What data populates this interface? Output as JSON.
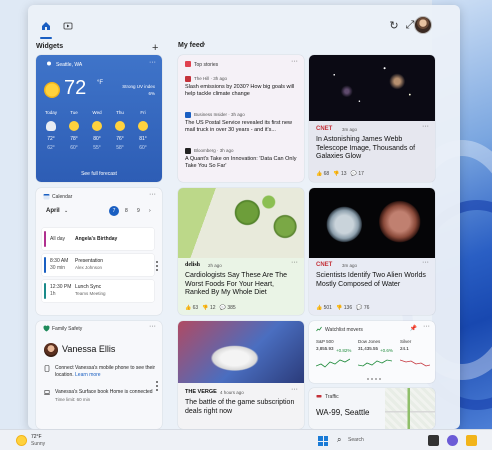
{
  "topbar": {
    "home_icon": "home-icon",
    "media_icon": "media-icon",
    "refresh_icon": "refresh-icon",
    "expand_icon": "expand-icon"
  },
  "widgets_section": {
    "label": "Widgets",
    "add": "+"
  },
  "weather": {
    "location": "Seattle, WA",
    "temp": "72",
    "unit": "°F",
    "condition_line1": "Strong UV index",
    "condition_line2": "6%",
    "forecast": [
      {
        "day": "Today",
        "icon": "cloud",
        "hi": "72°",
        "lo": "62°"
      },
      {
        "day": "Tue",
        "icon": "sun",
        "hi": "78°",
        "lo": "60°"
      },
      {
        "day": "Wed",
        "icon": "sun",
        "hi": "80°",
        "lo": "55°"
      },
      {
        "day": "Thu",
        "icon": "sun",
        "hi": "76°",
        "lo": "58°"
      },
      {
        "day": "Fri",
        "icon": "sun",
        "hi": "81°",
        "lo": "60°"
      }
    ],
    "see_full": "See full forecast"
  },
  "calendar": {
    "title": "Calendar",
    "month": "April",
    "days": [
      "7",
      "8",
      "9"
    ],
    "events": [
      {
        "t1": "All day",
        "t2": "",
        "title": "Angela's Birthday",
        "sub": "",
        "color": "#b0308f"
      },
      {
        "t1": "8:30 AM",
        "t2": "30 min",
        "title": "Presentation",
        "sub": "Alex Johnson",
        "color": "#1a5fc2"
      },
      {
        "t1": "12:30 PM",
        "t2": "1h",
        "title": "Lunch Sync",
        "sub": "Teams Meeting",
        "color": "#1a8a8a"
      }
    ]
  },
  "family": {
    "title": "Family Safety",
    "name": "Vanessa Ellis",
    "items": [
      {
        "text": "Connect Vanessa's mobile phone to see their location.",
        "link": "Learn more",
        "time": ""
      },
      {
        "text": "Vanessa's Surface book Home is connected",
        "link": "",
        "time": "Time limit: 60 min"
      }
    ]
  },
  "feed": {
    "label": "My feed",
    "top_stories": {
      "title": "Top stories",
      "items": [
        {
          "source": "The Hill · 3h ago",
          "headline": "Slash emissions by 2030? How big goals will help tackle climate change",
          "color": "#c4323a"
        },
        {
          "source": "Business Insider · 3h ago",
          "headline": "The US Postal Service revealed its first new mail truck in over 30 years - and it's...",
          "color": "#1a5fc2"
        },
        {
          "source": "Bloomberg · 3h ago",
          "headline": "A Quant's Take on Innovation: 'Data Can Only Take You So Far'",
          "color": "#222222"
        }
      ]
    },
    "space": {
      "source": "CNET",
      "time": "3m ago",
      "headline": "In Astonishing James Webb Telescope Image, Thousands of Galaxies Glow",
      "likes": "68",
      "dislikes": "13",
      "comments": "17"
    },
    "health": {
      "source": "delish",
      "time": "2h ago",
      "headline": "Cardiologists Say These Are The Worst Foods For Your Heart, Ranked By My Whole Diet",
      "likes": "63",
      "dislikes": "12",
      "comments": "385"
    },
    "science": {
      "source": "CNET",
      "time": "3m ago",
      "headline": "Scientists Identify Two Alien Worlds Mostly Composed of Water",
      "likes": "501",
      "dislikes": "136",
      "comments": "76"
    },
    "gaming": {
      "source": "THE VERGE",
      "time": "4 hours ago",
      "headline": "The battle of the game subscription deals right now"
    },
    "stocks": {
      "title": "Watchlist movers",
      "items": [
        {
          "name": "S&P 500",
          "value": "3,855.93",
          "change": "+0.82%",
          "color": "#1e8a3a"
        },
        {
          "name": "Dow Jones",
          "value": "31,435.55",
          "change": "+0.6%",
          "color": "#1e8a3a"
        },
        {
          "name": "Silver",
          "value": "24.1",
          "change": "",
          "color": "#c4323a"
        }
      ]
    },
    "traffic": {
      "title": "Traffic",
      "road": "WA-99, Seattle"
    }
  },
  "taskbar": {
    "temp": "72°F",
    "condition": "Sunny",
    "search": "Search"
  }
}
